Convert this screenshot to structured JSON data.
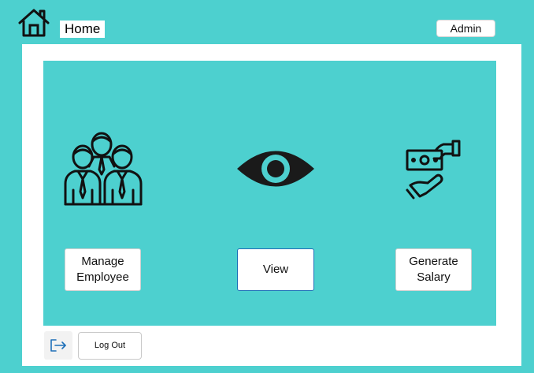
{
  "header": {
    "home_label": "Home",
    "admin_label": "Admin",
    "home_icon": "home-icon"
  },
  "actions": [
    {
      "label_line1": "Manage",
      "label_line2": "Employee",
      "icon": "employees-icon"
    },
    {
      "label": "View",
      "icon": "eye-icon"
    },
    {
      "label_line1": "Generate",
      "label_line2": "Salary",
      "icon": "salary-payment-icon"
    }
  ],
  "footer": {
    "logout_label": "Log Out",
    "logout_icon": "logout-icon"
  },
  "colors": {
    "background": "#4dd0cf",
    "panel": "#4dd0cf",
    "content": "#ffffff",
    "view_border": "#1e6fb8",
    "logout_icon": "#1e6fb8"
  }
}
